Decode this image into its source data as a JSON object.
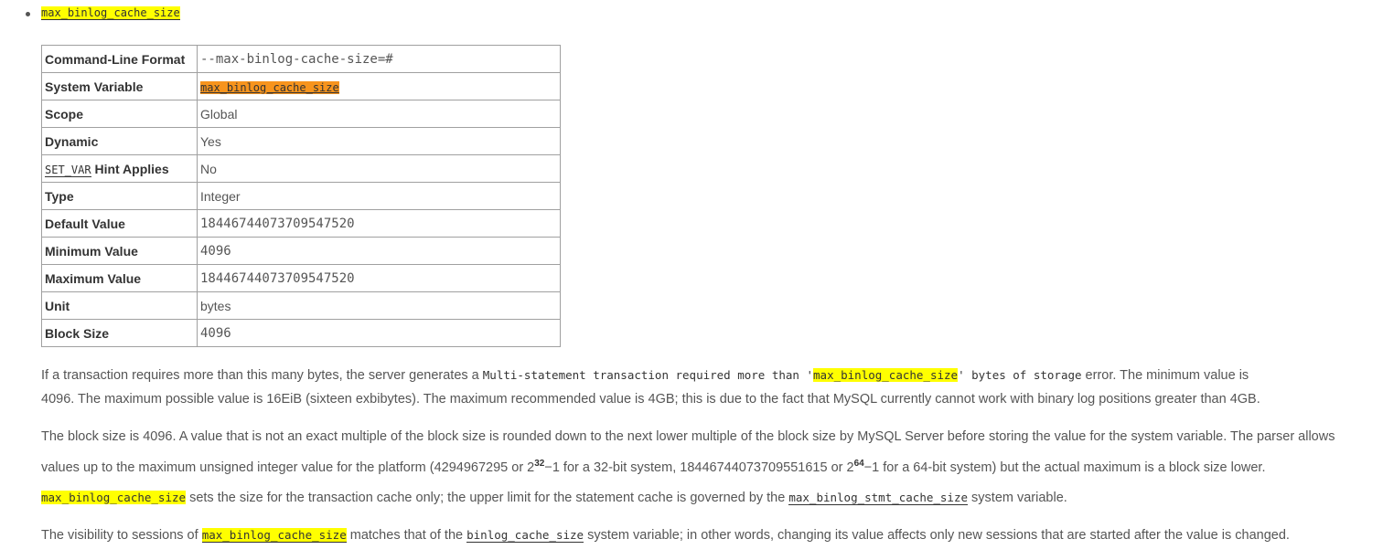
{
  "heading": {
    "variable": "max_binlog_cache_size"
  },
  "table": {
    "rows": [
      {
        "key": "Command-Line Format",
        "value": "--max-binlog-cache-size=#",
        "mono": true
      },
      {
        "key": "System Variable",
        "value": "max_binlog_cache_size",
        "mono": true,
        "highlight": "#f7941d"
      },
      {
        "key": "Scope",
        "value": "Global"
      },
      {
        "key": "Dynamic",
        "value": "Yes"
      },
      {
        "key_code": "SET_VAR",
        "key": " Hint Applies",
        "value": "No"
      },
      {
        "key": "Type",
        "value": "Integer"
      },
      {
        "key": "Default Value",
        "value": "18446744073709547520",
        "mono": true
      },
      {
        "key": "Minimum Value",
        "value": "4096",
        "mono": true
      },
      {
        "key": "Maximum Value",
        "value": "18446744073709547520",
        "mono": true
      },
      {
        "key": "Unit",
        "value": "bytes"
      },
      {
        "key": "Block Size",
        "value": "4096",
        "mono": true
      }
    ]
  },
  "p1": {
    "t1": "If a transaction requires more than this many bytes, the server generates a ",
    "c1": "Multi-statement transaction required more than '",
    "c2": "max_binlog_cache_size",
    "c3": "' bytes of storage",
    "t2": " error. The minimum value is",
    "t3": "4096. The maximum possible value is 16EiB (sixteen exbibytes). The maximum recommended value is 4GB; this is due to the fact that MySQL currently cannot work with binary log positions greater than 4GB."
  },
  "p2": {
    "t1": "The block size is 4096. A value that is not an exact multiple of the block size is rounded down to the next lower multiple of the block size by MySQL Server before storing the value for the system variable. The parser allows",
    "t2": "values up to the maximum unsigned integer value for the platform (4294967295 or 2",
    "sup1": "32",
    "t3": "−1 for a 32-bit system, 18446744073709551615 or 2",
    "sup2": "64",
    "t4": "−1 for a 64-bit system) but the actual maximum is a block size lower."
  },
  "p3": {
    "c1": "max_binlog_cache_size",
    "t1": " sets the size for the transaction cache only; the upper limit for the statement cache is governed by the ",
    "c2": "max_binlog_stmt_cache_size",
    "t2": " system variable."
  },
  "p4": {
    "t1": "The visibility to sessions of ",
    "c1": "max_binlog_cache_size",
    "t2": " matches that of the ",
    "c2": "binlog_cache_size",
    "t3": " system variable; in other words, changing its value affects only new sessions that are started after the value is changed."
  },
  "colors": {
    "highlight": "#ffff00",
    "system_variable_highlight": "#f7941d",
    "text": "#555555",
    "border": "#a0a0a0"
  }
}
